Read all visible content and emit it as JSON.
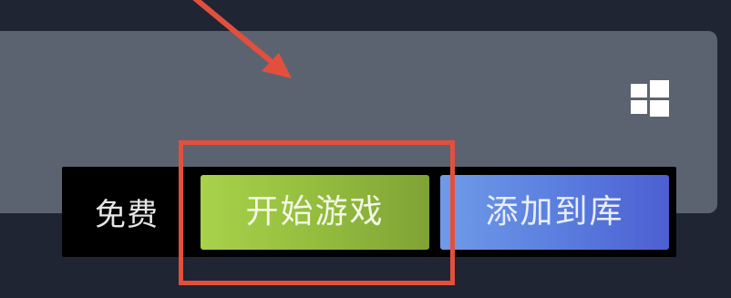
{
  "store_panel": {
    "platform_icon": "windows-icon"
  },
  "purchase": {
    "price_label": "免费",
    "play_button_label": "开始游戏",
    "add_to_library_label": "添加到库"
  },
  "annotation": {
    "highlight_color": "#e2503d"
  },
  "colors": {
    "play_button": "#92bb3d",
    "library_button": "#5b7fdf",
    "panel": "#5c6370",
    "background": "#1f2533"
  }
}
